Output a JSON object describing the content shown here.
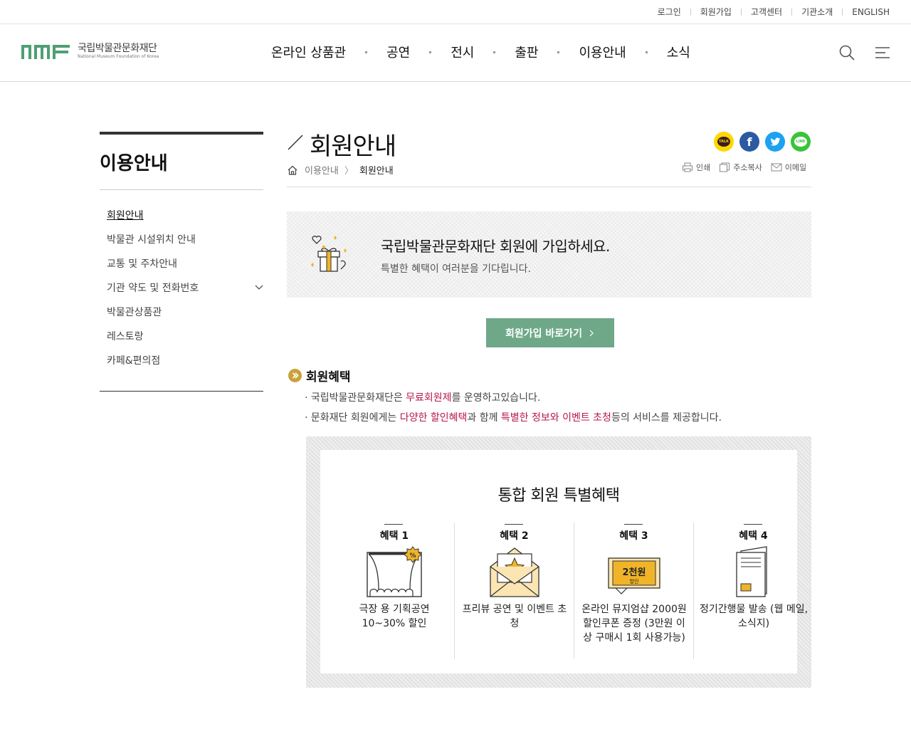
{
  "util": {
    "items": [
      "로그인",
      "회원가입",
      "고객센터",
      "기관소개",
      "ENGLISH"
    ]
  },
  "logo": {
    "ko": "국립박물관문화재단",
    "en": "National Museum Foundation of Korea"
  },
  "gnb": [
    "온라인 상품관",
    "공연",
    "전시",
    "출판",
    "이용안내",
    "소식"
  ],
  "lnb": {
    "title": "이용안내",
    "items": [
      "회원안내",
      "박물관 시설위치 안내",
      "교통 및 주차안내",
      "기관 약도 및 전화번호",
      "박물관상품관",
      "레스토랑",
      "카페&편의점"
    ]
  },
  "page": {
    "title": "회원안내",
    "breadcrumb": {
      "parent": "이용안내",
      "current": "회원안내"
    }
  },
  "sns": {
    "kakao": "TALK",
    "facebook": "f",
    "line": "LINE"
  },
  "tools": {
    "print": "인쇄",
    "copy": "주소복사",
    "email": "이메일"
  },
  "banner": {
    "heading": "국립박물관문화재단 회원에 가입하세요.",
    "sub": "특별한 혜택이 여러분을 기다립니다."
  },
  "join_button": "회원가입 바로가기",
  "section": {
    "title": "회원혜택",
    "b1": {
      "pre": "국립박물관문화재단은 ",
      "hl": "무료회원제",
      "post": "를 운영하고있습니다."
    },
    "b2": {
      "pre": "문화재단 회원에게는 ",
      "hl1": "다양한 할인혜택",
      "mid": "과 함께 ",
      "hl2": "특별한 정보와 이벤트 초청",
      "post": "등의 서비스를 제공합니다."
    }
  },
  "benefits": {
    "title": "통합 회원 특별혜택",
    "items": [
      {
        "label": "혜택 1",
        "desc": "극장 용 기획공연 10~30% 할인"
      },
      {
        "label": "혜택 2",
        "desc": "프리뷰 공연 및 이벤트 초청"
      },
      {
        "label": "혜택 3",
        "desc": "온라인 뮤지엄샵 2000원 할인쿠폰 증정 (3만원 이상 구매시 1회 사용가능)",
        "coupon_text": "2천원",
        "coupon_sub": "할인"
      },
      {
        "label": "혜택 4",
        "desc": "정기간행물 발송 (웹 메일, 소식지)"
      }
    ]
  },
  "colors": {
    "accent": "#6ea889",
    "highlight": "#b8164f",
    "logo": "#4f9f73",
    "gold": "#f0b429"
  }
}
